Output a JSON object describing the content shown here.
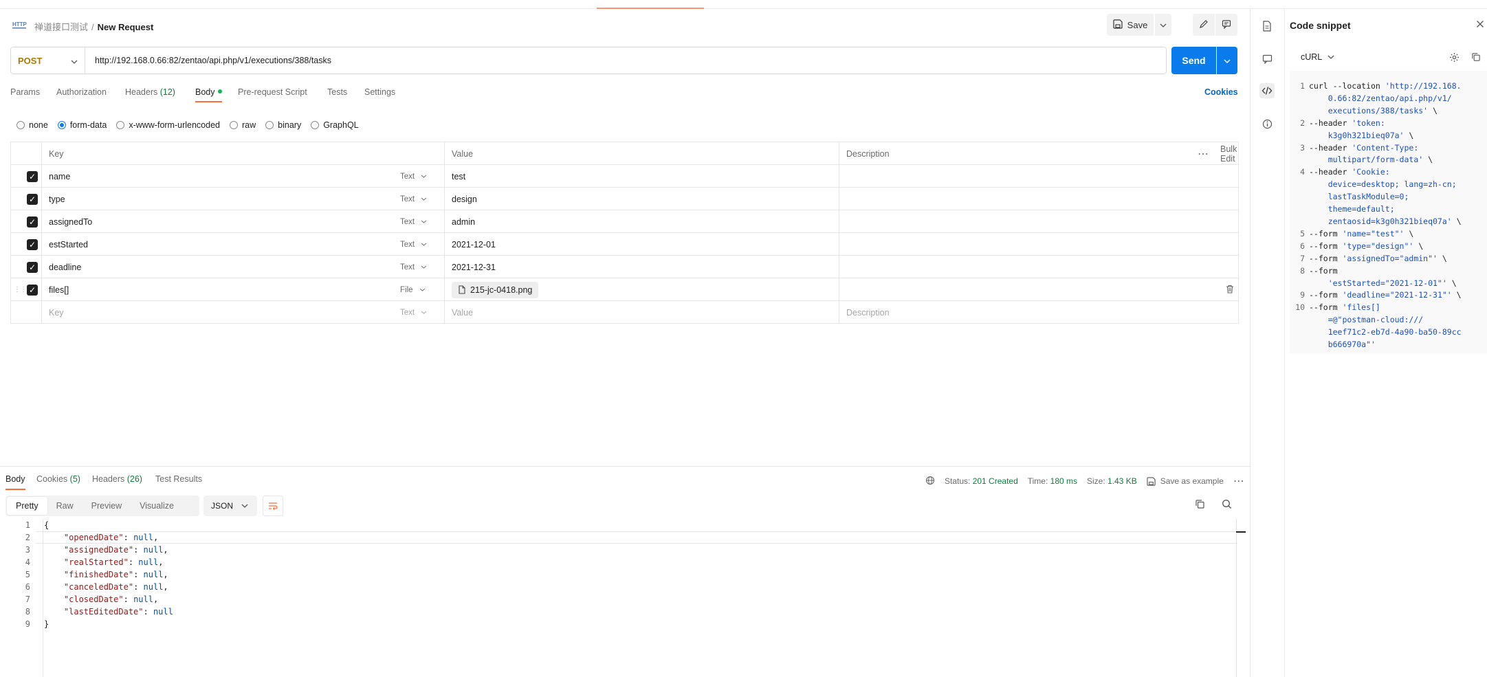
{
  "breadcrumb": {
    "parent": "禅道接口测试",
    "separator": "/",
    "current": "New Request"
  },
  "toolbar": {
    "save_label": "Save"
  },
  "request": {
    "method": "POST",
    "url": "http://192.168.0.66:82/zentao/api.php/v1/executions/388/tasks",
    "send_label": "Send"
  },
  "tabs": {
    "params": "Params",
    "authorization": "Authorization",
    "headers": "Headers",
    "headers_count": "(12)",
    "body": "Body",
    "prerequest": "Pre-request Script",
    "tests": "Tests",
    "settings": "Settings",
    "cookies": "Cookies"
  },
  "body_types": [
    "none",
    "form-data",
    "x-www-form-urlencoded",
    "raw",
    "binary",
    "GraphQL"
  ],
  "body_type_selected": "form-data",
  "table": {
    "headers": {
      "key": "Key",
      "value": "Value",
      "description": "Description",
      "bulk_edit": "Bulk Edit"
    },
    "rows": [
      {
        "key": "name",
        "type": "Text",
        "value": "test"
      },
      {
        "key": "type",
        "type": "Text",
        "value": "design"
      },
      {
        "key": "assignedTo",
        "type": "Text",
        "value": "admin"
      },
      {
        "key": "estStarted",
        "type": "Text",
        "value": "2021-12-01"
      },
      {
        "key": "deadline",
        "type": "Text",
        "value": "2021-12-31"
      },
      {
        "key": "files[]",
        "type": "File",
        "value": "215-jc-0418.png"
      }
    ],
    "placeholder": {
      "key": "Key",
      "type": "Text",
      "value": "Value",
      "description": "Description"
    }
  },
  "response": {
    "tabs": {
      "body": "Body",
      "cookies": "Cookies",
      "cookies_count": "(5)",
      "headers": "Headers",
      "headers_count": "(26)",
      "test_results": "Test Results"
    },
    "status_label": "Status:",
    "status_value": "201 Created",
    "time_label": "Time:",
    "time_value": "180 ms",
    "size_label": "Size:",
    "size_value": "1.43 KB",
    "save_example": "Save as example",
    "views": [
      "Pretty",
      "Raw",
      "Preview",
      "Visualize"
    ],
    "format": "JSON",
    "lines": [
      {
        "n": "1",
        "text": "{"
      },
      {
        "n": "2",
        "key": "\"openedDate\"",
        "val": "null",
        "tail": ","
      },
      {
        "n": "3",
        "key": "\"assignedDate\"",
        "val": "null",
        "tail": ","
      },
      {
        "n": "4",
        "key": "\"realStarted\"",
        "val": "null",
        "tail": ","
      },
      {
        "n": "5",
        "key": "\"finishedDate\"",
        "val": "null",
        "tail": ","
      },
      {
        "n": "6",
        "key": "\"canceledDate\"",
        "val": "null",
        "tail": ","
      },
      {
        "n": "7",
        "key": "\"closedDate\"",
        "val": "null",
        "tail": ","
      },
      {
        "n": "8",
        "key": "\"lastEditedDate\"",
        "val": "null",
        "tail": ""
      },
      {
        "n": "9",
        "text": "}"
      }
    ]
  },
  "snippet": {
    "title": "Code snippet",
    "language": "cURL",
    "lines": [
      {
        "n": "1",
        "parts": [
          "curl --location ",
          "'http://192.168."
        ]
      },
      {
        "n": "",
        "parts": [
          "",
          "    0.66:82/zentao/api.php/v1/"
        ]
      },
      {
        "n": "",
        "parts": [
          "",
          "    executions/388/tasks'"
        ],
        "tail": " \\"
      },
      {
        "n": "2",
        "parts": [
          "--header ",
          "'token:"
        ]
      },
      {
        "n": "",
        "parts": [
          "",
          "    k3g0h321bieq07a'"
        ],
        "tail": " \\"
      },
      {
        "n": "3",
        "parts": [
          "--header ",
          "'Content-Type:"
        ]
      },
      {
        "n": "",
        "parts": [
          "",
          "    multipart/form-data'"
        ],
        "tail": " \\"
      },
      {
        "n": "4",
        "parts": [
          "--header ",
          "'Cookie:"
        ]
      },
      {
        "n": "",
        "parts": [
          "",
          "    device=desktop; lang=zh-cn;"
        ]
      },
      {
        "n": "",
        "parts": [
          "",
          "    lastTaskModule=0;"
        ]
      },
      {
        "n": "",
        "parts": [
          "",
          "    theme=default;"
        ]
      },
      {
        "n": "",
        "parts": [
          "",
          "    zentaosid=k3g0h321bieq07a'"
        ],
        "tail": " \\"
      },
      {
        "n": "5",
        "parts": [
          "--form ",
          "'name=\"test\"'"
        ],
        "tail": " \\"
      },
      {
        "n": "6",
        "parts": [
          "--form ",
          "'type=\"design\"'"
        ],
        "tail": " \\"
      },
      {
        "n": "7",
        "parts": [
          "--form ",
          "'assignedTo=\"admin\"'"
        ],
        "tail": " \\"
      },
      {
        "n": "8",
        "parts": [
          "--form",
          ""
        ]
      },
      {
        "n": "",
        "parts": [
          "",
          "    'estStarted=\"2021-12-01\"'"
        ],
        "tail": " \\"
      },
      {
        "n": "9",
        "parts": [
          "--form ",
          "'deadline=\"2021-12-31\"'"
        ],
        "tail": " \\"
      },
      {
        "n": "10",
        "parts": [
          "--form ",
          "'files[]"
        ]
      },
      {
        "n": "",
        "parts": [
          "",
          "    =@\"postman-cloud:///"
        ]
      },
      {
        "n": "",
        "parts": [
          "",
          "    1eef71c2-eb7d-4a90-ba50-89cc"
        ]
      },
      {
        "n": "",
        "parts": [
          "",
          "    b666970a\"'"
        ]
      }
    ]
  },
  "icons": {
    "http": "http-request-icon",
    "save": "save-disk-icon",
    "edit": "pencil-icon",
    "comment": "comment-icon",
    "globe": "globe-icon",
    "copy": "copy-icon",
    "search": "search-icon",
    "gear": "gear-icon",
    "doc": "document-icon",
    "code": "code-icon",
    "info": "info-icon",
    "close": "close-icon",
    "trash": "trash-icon"
  },
  "colors": {
    "accent": "#ff6c37",
    "send": "#097bed",
    "method": "#ad7a03",
    "status_ok": "#0d7d3c"
  }
}
